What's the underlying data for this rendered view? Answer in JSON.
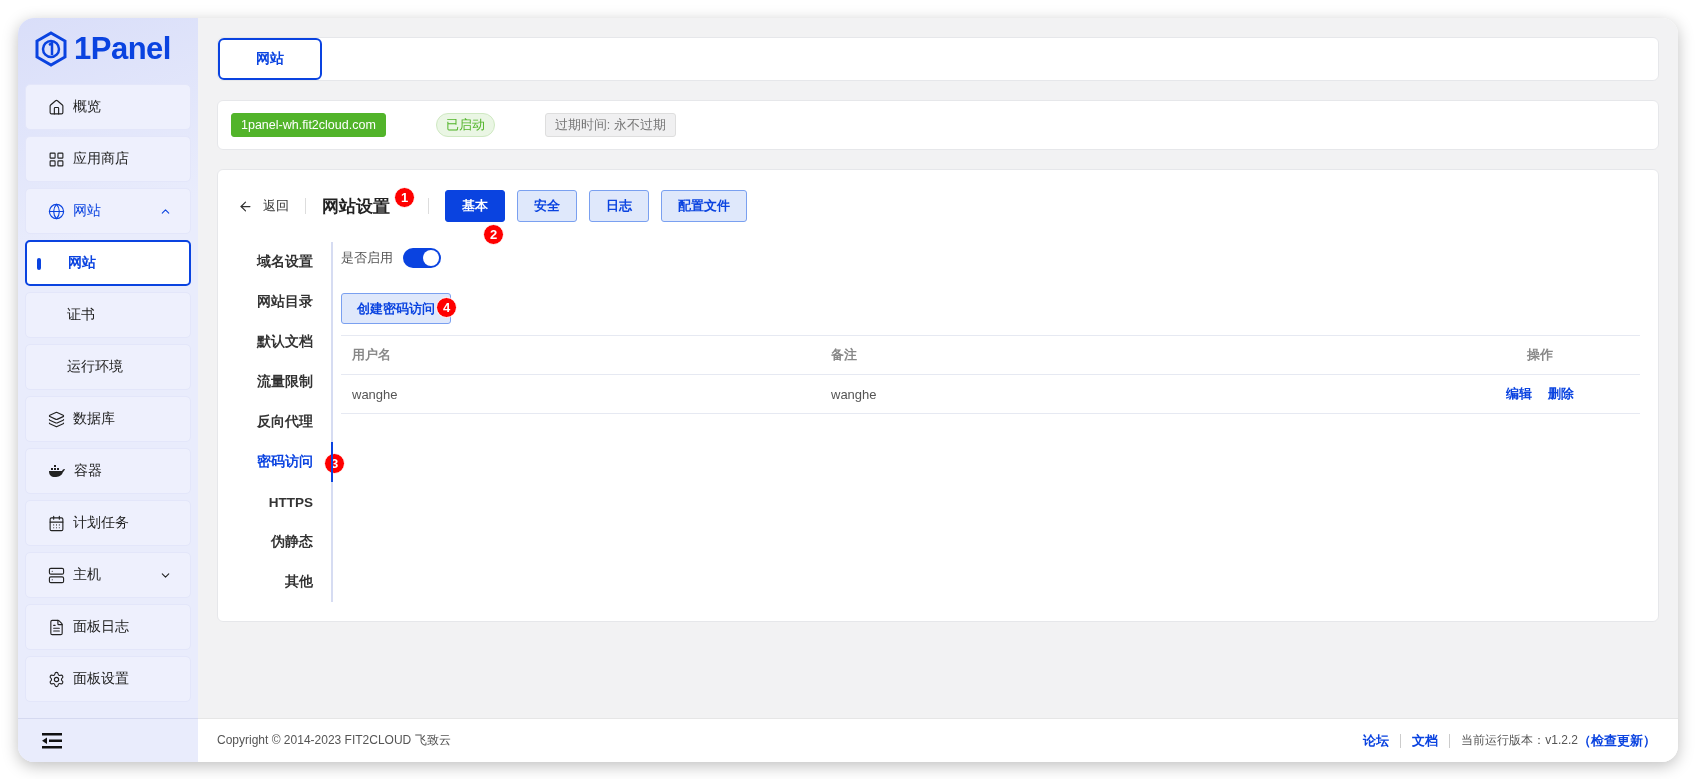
{
  "sidebar": {
    "logo": "1Panel",
    "items": [
      {
        "label": "概览",
        "selected": false
      },
      {
        "label": "应用商店",
        "selected": false
      },
      {
        "label": "网站",
        "selected": false,
        "expanded": true,
        "children": [
          {
            "label": "网站",
            "selected": true
          },
          {
            "label": "证书",
            "selected": false
          },
          {
            "label": "运行环境",
            "selected": false
          }
        ]
      },
      {
        "label": "数据库",
        "selected": false
      },
      {
        "label": "容器",
        "selected": false
      },
      {
        "label": "计划任务",
        "selected": false
      },
      {
        "label": "主机",
        "selected": false,
        "expanded": false
      },
      {
        "label": "面板日志",
        "selected": false
      },
      {
        "label": "面板设置",
        "selected": false
      }
    ]
  },
  "tabs": [
    {
      "label": "网站",
      "selected": true
    }
  ],
  "site_info": {
    "domain": "1panel-wh.fit2cloud.com",
    "status": "已启动",
    "expiry": "过期时间: 永不过期"
  },
  "settings": {
    "back": "返回",
    "title": "网站设置",
    "tabs": [
      {
        "label": "基本",
        "selected": true
      },
      {
        "label": "安全",
        "selected": false
      },
      {
        "label": "日志",
        "selected": false
      },
      {
        "label": "配置文件",
        "selected": false
      }
    ],
    "menu": [
      {
        "label": "域名设置",
        "selected": false
      },
      {
        "label": "网站目录",
        "selected": false
      },
      {
        "label": "默认文档",
        "selected": false
      },
      {
        "label": "流量限制",
        "selected": false
      },
      {
        "label": "反向代理",
        "selected": false
      },
      {
        "label": "密码访问",
        "selected": true
      },
      {
        "label": "HTTPS",
        "selected": false
      },
      {
        "label": "伪静态",
        "selected": false
      },
      {
        "label": "其他",
        "selected": false
      }
    ],
    "enable_label": "是否启用",
    "enabled": true,
    "create_button": "创建密码访问",
    "table": {
      "columns": [
        "用户名",
        "备注",
        "操作"
      ],
      "rows": [
        {
          "username": "wanghe",
          "remark": "wanghe",
          "actions": [
            "编辑",
            "删除"
          ]
        }
      ]
    }
  },
  "annotations": [
    {
      "number": "1"
    },
    {
      "number": "2"
    },
    {
      "number": "3"
    },
    {
      "number": "4"
    }
  ],
  "footer": {
    "copyright": "Copyright © 2014-2023 FIT2CLOUD 飞致云",
    "links": [
      "论坛",
      "文档"
    ],
    "version": "当前运行版本：v1.2.2",
    "check_update": "（检查更新）"
  }
}
